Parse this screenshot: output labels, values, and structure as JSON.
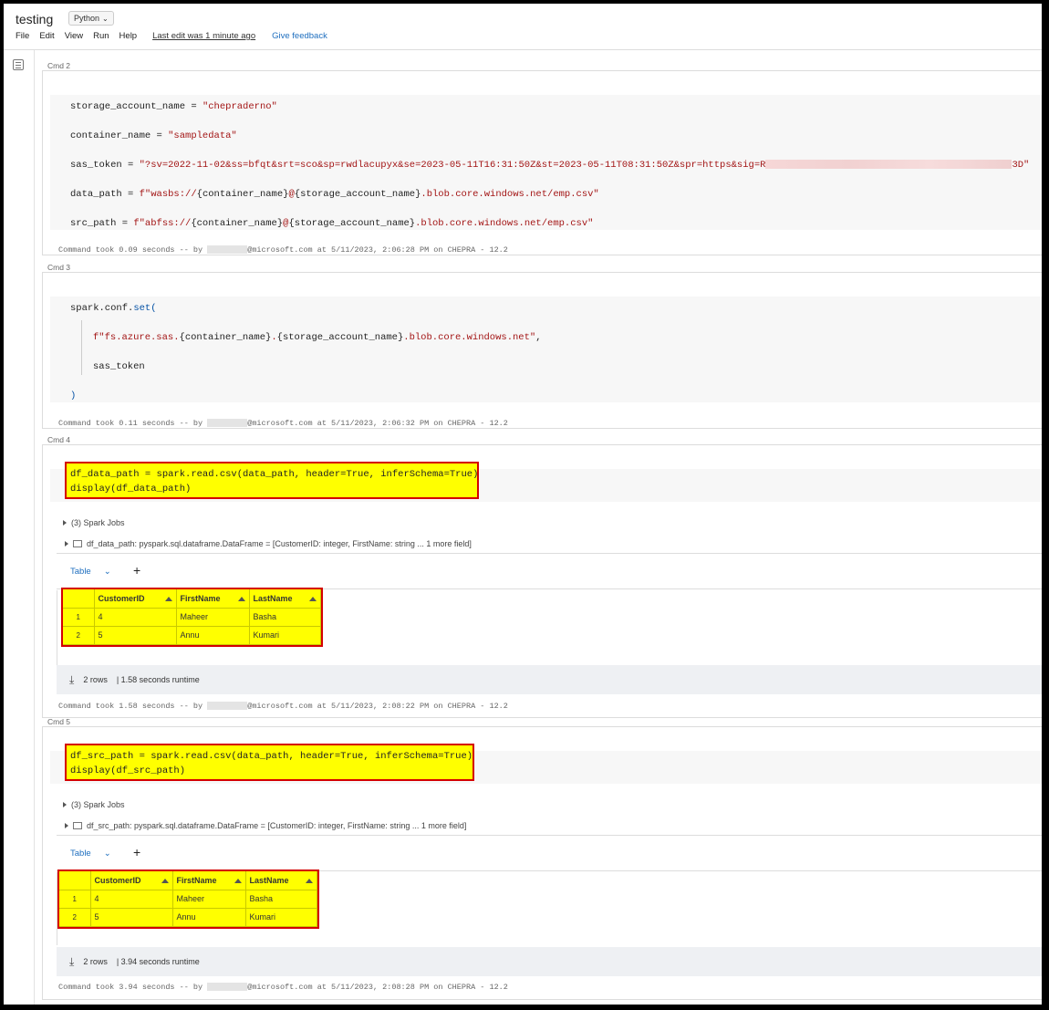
{
  "header": {
    "title": "testing",
    "language": "Python",
    "menu": [
      "File",
      "Edit",
      "View",
      "Run",
      "Help"
    ],
    "last_edit": "Last edit was 1 minute ago",
    "feedback": "Give feedback"
  },
  "cells": {
    "cmd2": {
      "label": "Cmd 2",
      "lines": {
        "l1a": "storage_account_name = ",
        "l1b": "\"chepraderno\"",
        "l2a": "container_name = ",
        "l2b": "\"sampledata\"",
        "l3a": "sas_token = ",
        "l3b": "\"?sv=2022-11-02&ss=bfqt&srt=sco&sp=rwdlacupyx&se=2023-05-11T16:31:50Z&st=2023-05-11T08:31:50Z&spr=https&sig=R",
        "l3c": "3D\"",
        "l4a": "data_path = ",
        "l4b": "f\"wasbs://",
        "l4c": "{container_name}",
        "l4d": "@",
        "l4e": "{storage_account_name}",
        "l4f": ".blob.core.windows.net/emp.csv\"",
        "l5a": "src_path = ",
        "l5b": "f\"abfss://",
        "l5c": "{container_name}",
        "l5d": "@",
        "l5e": "{storage_account_name}",
        "l5f": ".blob.core.windows.net/emp.csv\""
      },
      "took_a": "Command took 0.09 seconds -- by ",
      "took_b": "@microsoft.com at 5/11/2023, 2:06:28 PM on CHEPRA - 12.2"
    },
    "cmd3": {
      "label": "Cmd 3",
      "lines": {
        "l1a": "spark.conf.",
        "l1b": "set",
        "l1c": "(",
        "l2a": "f\"fs.azure.sas.",
        "l2b": "{container_name}",
        "l2c": ".",
        "l2d": "{storage_account_name}",
        "l2e": ".blob.core.windows.net\"",
        "l2f": ",",
        "l3": "sas_token",
        "l4": ")"
      },
      "took_a": "Command took 0.11 seconds -- by ",
      "took_b": "@microsoft.com at 5/11/2023, 2:06:32 PM on CHEPRA - 12.2"
    },
    "cmd4": {
      "label": "Cmd 4",
      "code1": "df_data_path = spark.read.csv(data_path, header=True, inferSchema=True)",
      "code2": "display(df_data_path)",
      "jobs": "(3) Spark Jobs",
      "df": "df_data_path:  pyspark.sql.dataframe.DataFrame = [CustomerID: integer, FirstName: string ... 1 more field]",
      "tab": "Table",
      "columns": [
        "CustomerID",
        "FirstName",
        "LastName"
      ],
      "rows": [
        [
          "1",
          "4",
          "Maheer",
          "Basha"
        ],
        [
          "2",
          "5",
          "Annu",
          "Kumari"
        ]
      ],
      "rows_count": "2 rows",
      "runtime": "|  1.58 seconds runtime",
      "took_a": "Command took 1.58 seconds -- by ",
      "took_b": "@microsoft.com at 5/11/2023, 2:08:22 PM on CHEPRA - 12.2"
    },
    "cmd5": {
      "label": "Cmd 5",
      "code1": "df_src_path = spark.read.csv(data_path, header=True, inferSchema=True)",
      "code2": "display(df_src_path)",
      "jobs": "(3) Spark Jobs",
      "df": "df_src_path:  pyspark.sql.dataframe.DataFrame = [CustomerID: integer, FirstName: string ... 1 more field]",
      "tab": "Table",
      "columns": [
        "CustomerID",
        "FirstName",
        "LastName"
      ],
      "rows": [
        [
          "1",
          "4",
          "Maheer",
          "Basha"
        ],
        [
          "2",
          "5",
          "Annu",
          "Kumari"
        ]
      ],
      "rows_count": "2 rows",
      "runtime": "|  3.94 seconds runtime",
      "took_a": "Command took 3.94 seconds -- by ",
      "took_b": "@microsoft.com at 5/11/2023, 2:08:28 PM on CHEPRA - 12.2"
    }
  },
  "colors": {
    "highlight": "#ffff00",
    "annotation_border": "#d40000",
    "link": "#1f6fbf",
    "string": "#a31515"
  },
  "icons": [
    "chevron-down-icon",
    "table-of-contents-icon",
    "expand-triangle-icon",
    "dataframe-table-icon",
    "add-tab-icon",
    "download-icon",
    "sort-icon"
  ]
}
